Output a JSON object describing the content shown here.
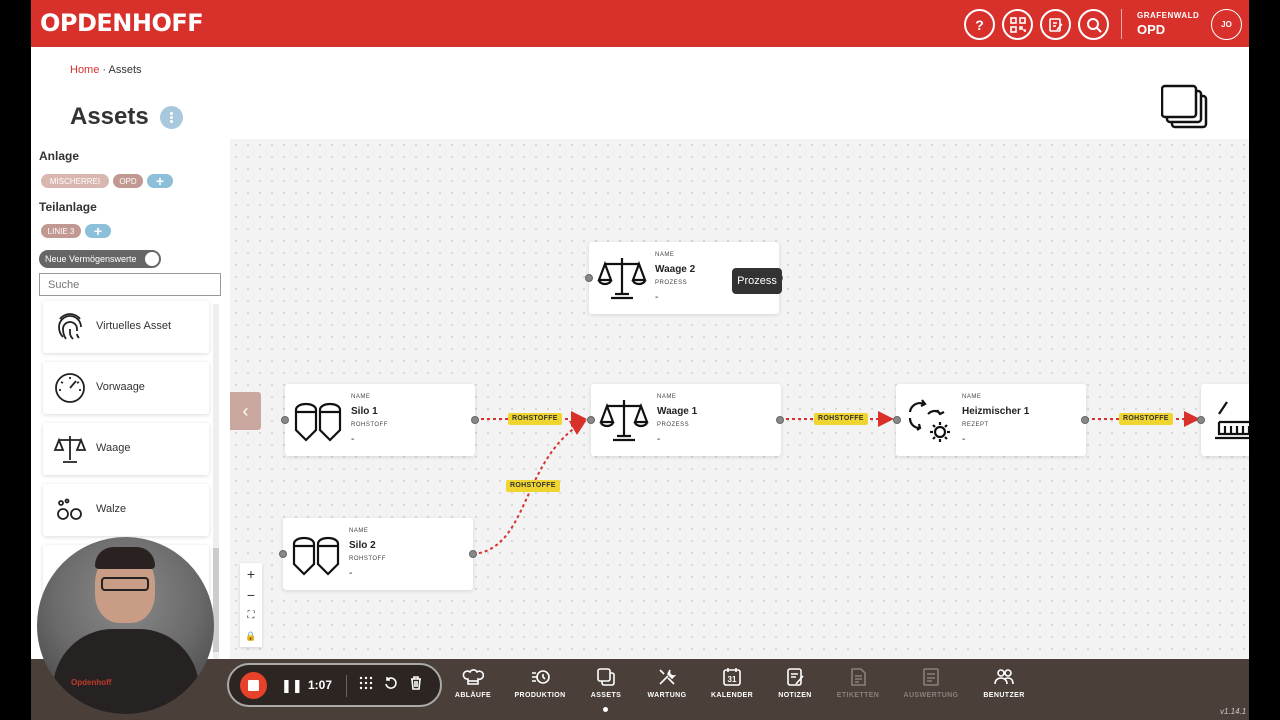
{
  "header": {
    "logo": "OPDENHOFF",
    "site_label": "GRAFENWALD",
    "site_code": "OPD",
    "user_initials": "JO"
  },
  "breadcrumb": {
    "home": "Home",
    "separator": " · ",
    "current": "Assets"
  },
  "page": {
    "title": "Assets"
  },
  "sidebar": {
    "anlage_label": "Anlage",
    "anlage_chips": [
      "MISCHERREI",
      "OPD"
    ],
    "teilanlage_label": "Teilanlage",
    "teilanlage_chips": [
      "LINIE 3"
    ],
    "plus": "+",
    "toggle_label": "Neue Vermögenswerte",
    "search_placeholder": "Suche",
    "assets": [
      "Virtuelles Asset",
      "Vorwaage",
      "Waage",
      "Walze"
    ]
  },
  "canvas": {
    "nodes": {
      "waage2": {
        "k1": "NAME",
        "name": "Waage 2",
        "k2": "PROZESS",
        "value": "-"
      },
      "silo1": {
        "k1": "NAME",
        "name": "Silo 1",
        "k2": "ROHSTOFF",
        "value": "-"
      },
      "waage1": {
        "k1": "NAME",
        "name": "Waage 1",
        "k2": "PROZESS",
        "value": "-"
      },
      "heizmischer1": {
        "k1": "NAME",
        "name": "Heizmischer 1",
        "k2": "REZEPT",
        "value": "-"
      },
      "silo2": {
        "k1": "NAME",
        "name": "Silo 2",
        "k2": "ROHSTOFF",
        "value": "-"
      }
    },
    "edge_label": "ROHSTOFFE",
    "tooltip": "Prozess",
    "collapse": "‹",
    "zoom": [
      "+",
      "−",
      "⛶",
      "🔒"
    ]
  },
  "recorder": {
    "time": "1:07",
    "pause": "❚❚"
  },
  "nav": [
    {
      "label": "ABLÄUFE",
      "icon": "chef-hat-icon",
      "enabled": true
    },
    {
      "label": "PRODUKTION",
      "icon": "production-icon",
      "enabled": true
    },
    {
      "label": "ASSETS",
      "icon": "assets-stack-icon",
      "enabled": true
    },
    {
      "label": "WARTUNG",
      "icon": "tools-icon",
      "enabled": true
    },
    {
      "label": "KALENDER",
      "icon": "calendar-icon",
      "enabled": true
    },
    {
      "label": "NOTIZEN",
      "icon": "notes-icon",
      "enabled": true
    },
    {
      "label": "ETIKETTEN",
      "icon": "label-icon",
      "enabled": false
    },
    {
      "label": "AUSWERTUNG",
      "icon": "report-icon",
      "enabled": false
    },
    {
      "label": "BENUTZER",
      "icon": "users-icon",
      "enabled": true
    }
  ],
  "calendar_day": "31",
  "version": "v1.14.1",
  "webcam_brand": "Opdenhoff",
  "colors": {
    "brand_red": "#d8312c",
    "edge_yellow": "#f0d531",
    "bottom_bar": "#4a3f39"
  }
}
